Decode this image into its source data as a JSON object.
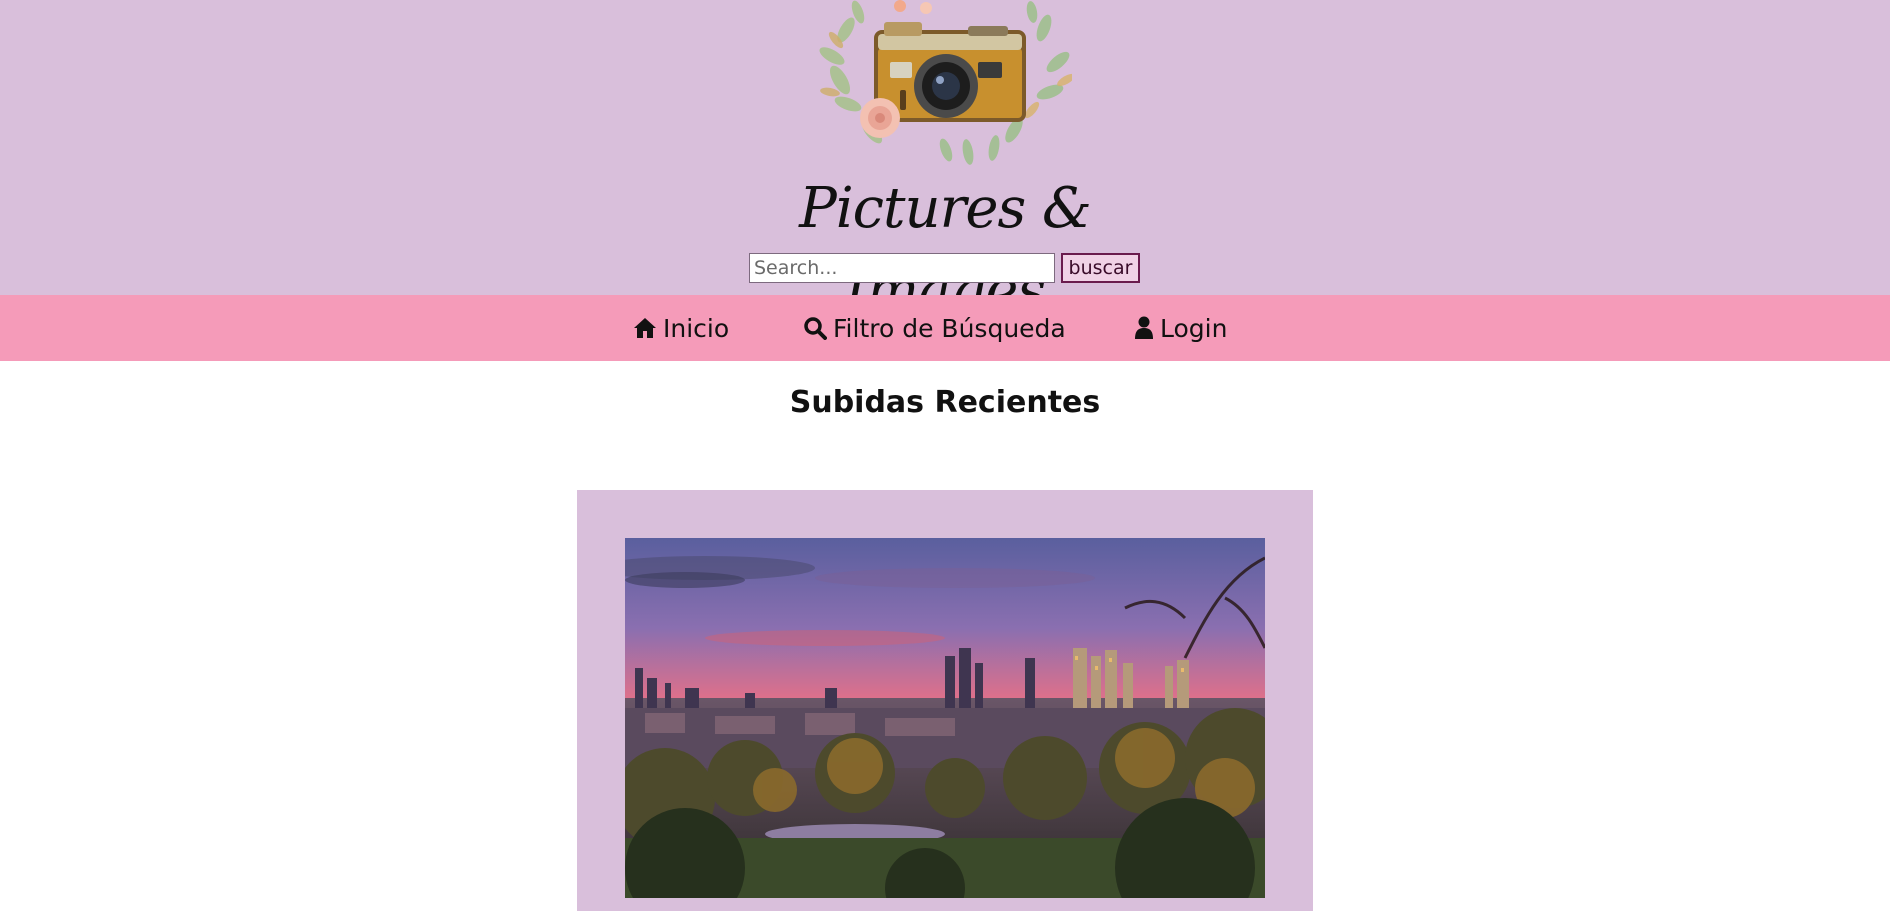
{
  "header": {
    "logo_icon": "camera-wreath-logo",
    "brand_title": "Pictures & Images",
    "search": {
      "placeholder": "Search...",
      "value": "",
      "button_label": "buscar"
    }
  },
  "nav": {
    "items": [
      {
        "icon": "home-icon",
        "label": "Inicio"
      },
      {
        "icon": "search-icon",
        "label": "Filtro de Búsqueda"
      },
      {
        "icon": "user-icon",
        "label": "Login"
      }
    ]
  },
  "main": {
    "section_title": "Subidas Recientes",
    "recent_uploads": [
      {
        "image": "city-skyline-sunset-photo"
      }
    ]
  },
  "colors": {
    "header_bg": "#d9bfdb",
    "nav_bg": "#f59bb9",
    "card_bg": "#d9bfdb",
    "button_border": "#6a1b4d"
  }
}
